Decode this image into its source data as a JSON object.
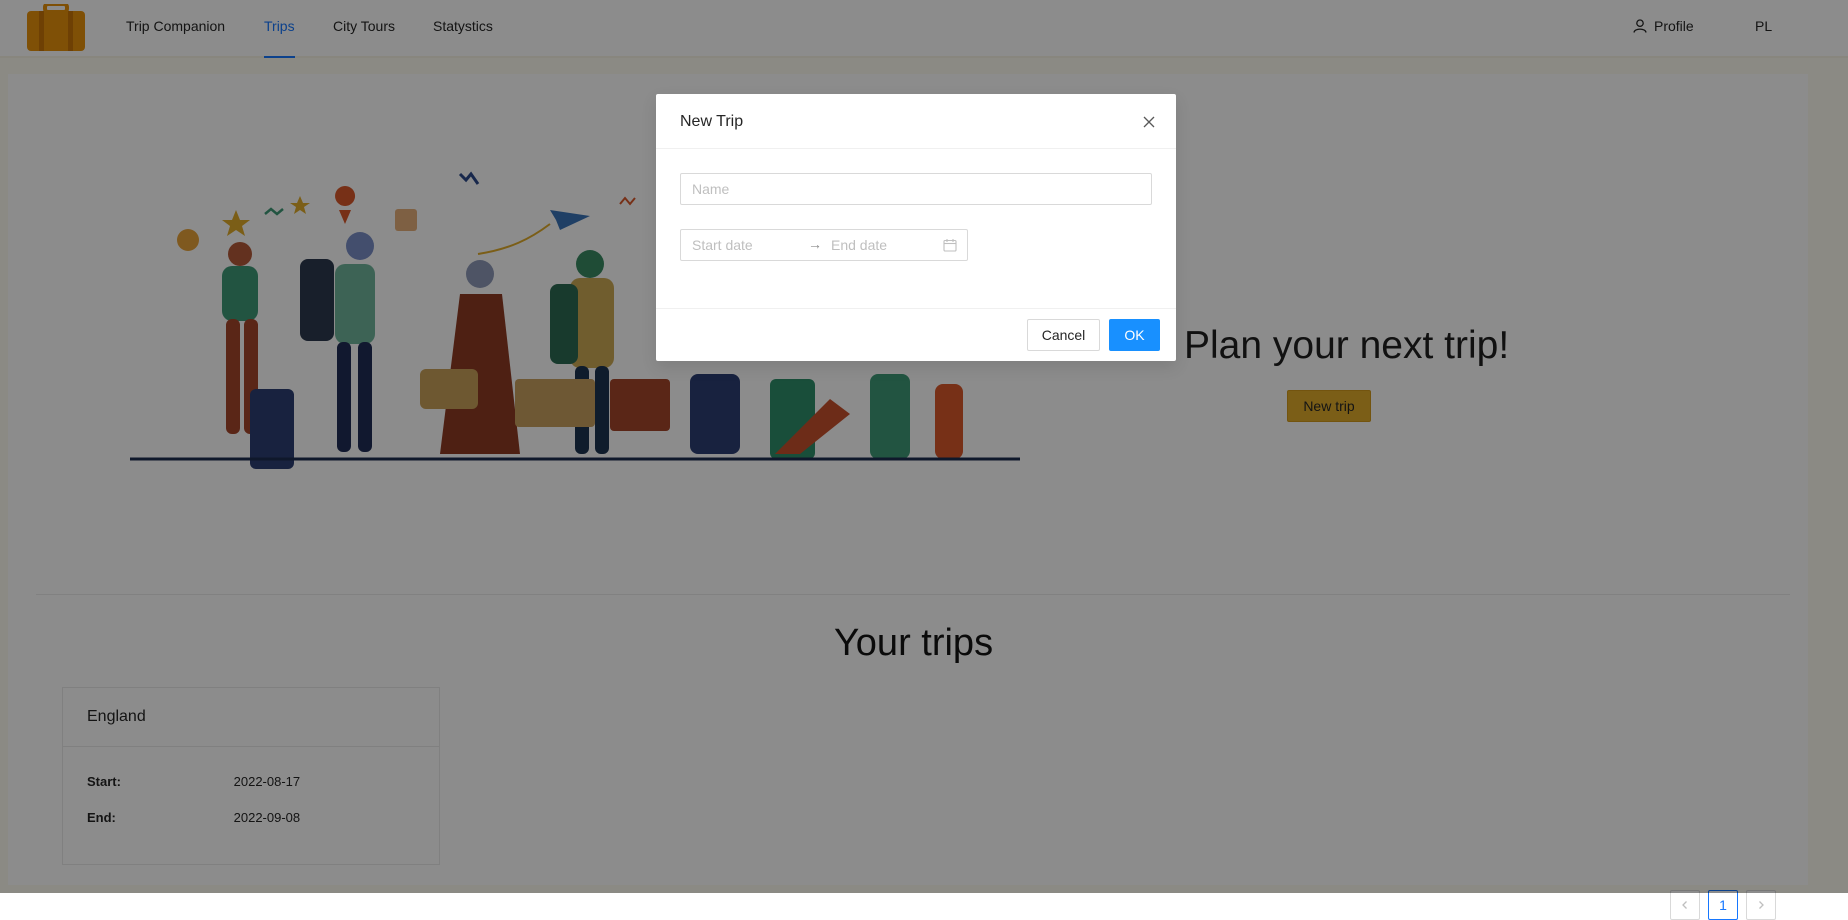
{
  "nav": {
    "items": [
      {
        "label": "Trip Companion"
      },
      {
        "label": "Trips"
      },
      {
        "label": "City Tours"
      },
      {
        "label": "Statystics"
      }
    ],
    "active": "Trips",
    "profile_label": "Profile",
    "language": "PL"
  },
  "hero": {
    "title": "Plan your next trip!",
    "button_label": "New trip"
  },
  "trips_section": {
    "title": "Your trips",
    "cards": [
      {
        "name": "England",
        "start_label": "Start:",
        "start": "2022-08-17",
        "end_label": "End:",
        "end": "2022-09-08"
      }
    ]
  },
  "pagination": {
    "current": "1",
    "prev_icon": "chevron-left-icon",
    "next_icon": "chevron-right-icon"
  },
  "modal": {
    "title": "New Trip",
    "name_placeholder": "Name",
    "start_placeholder": "Start date",
    "end_placeholder": "End date",
    "arrow": "→",
    "cancel_label": "Cancel",
    "ok_label": "OK"
  },
  "colors": {
    "brand": "#e0ac2a",
    "logo": "#e8930c",
    "primary": "#1890ff",
    "overlay": "rgba(0,0,0,0.45)"
  }
}
